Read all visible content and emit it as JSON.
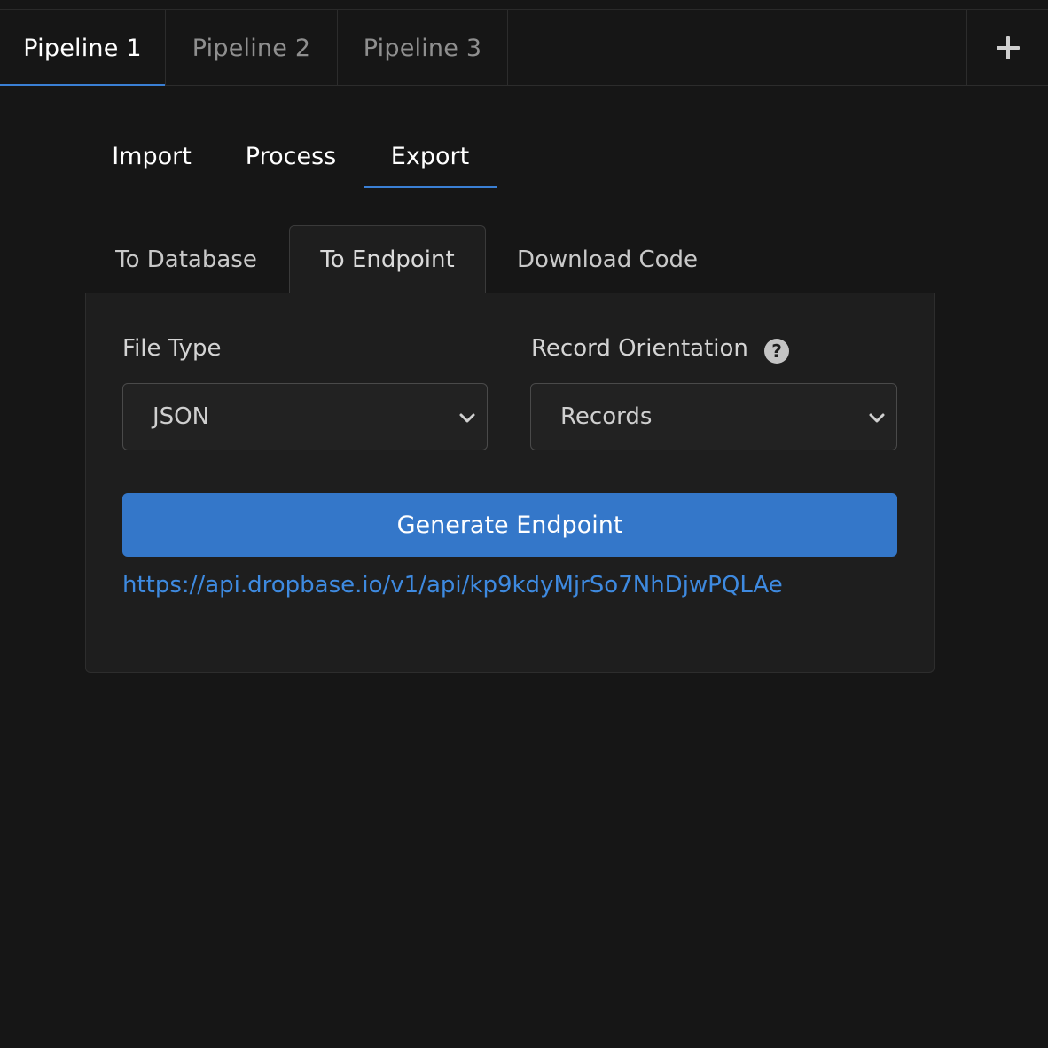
{
  "pipelines": {
    "tabs": [
      {
        "label": "Pipeline 1",
        "active": true
      },
      {
        "label": "Pipeline 2",
        "active": false
      },
      {
        "label": "Pipeline 3",
        "active": false
      }
    ],
    "add_icon": "plus-icon"
  },
  "stages": {
    "tabs": [
      {
        "label": "Import",
        "active": false
      },
      {
        "label": "Process",
        "active": false
      },
      {
        "label": "Export",
        "active": true
      }
    ]
  },
  "export": {
    "tabs": [
      {
        "label": "To Database",
        "active": false
      },
      {
        "label": "To Endpoint",
        "active": true
      },
      {
        "label": "Download Code",
        "active": false
      }
    ],
    "file_type": {
      "label": "File Type",
      "value": "JSON"
    },
    "record_orientation": {
      "label": "Record Orientation",
      "value": "Records",
      "help_icon": "question-icon"
    },
    "generate_button": "Generate Endpoint",
    "endpoint_url": "https://api.dropbase.io/v1/api/kp9kdyMjrSo7NhDjwPQLAe"
  },
  "colors": {
    "background": "#161616",
    "panel": "#1e1e1e",
    "accent": "#3477c9",
    "link": "#3e8ae0",
    "tab_underline": "#3a7fd4"
  }
}
